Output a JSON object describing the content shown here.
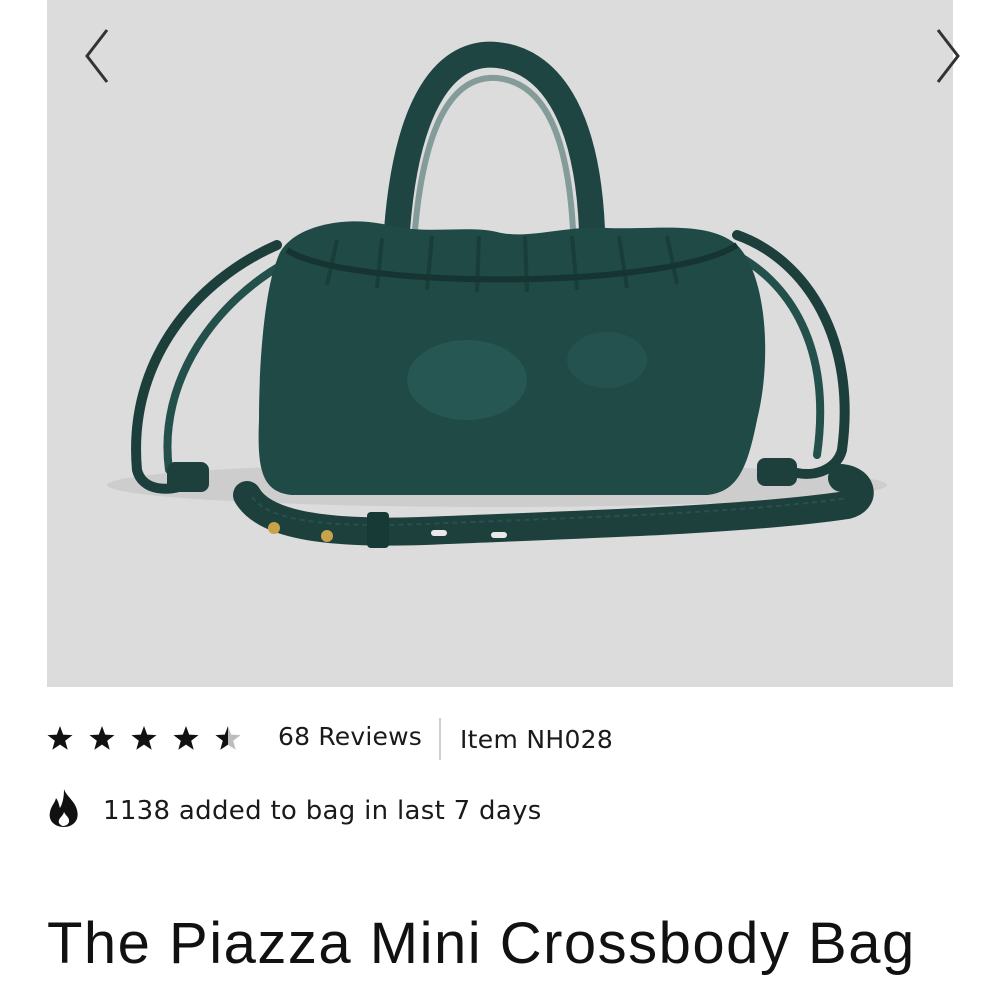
{
  "gallery": {
    "image_alt": "The Piazza Mini Crossbody Bag in dark green leather",
    "prev_icon": "chevron-left-icon",
    "next_icon": "chevron-right-icon",
    "background": "#dcdcdc",
    "bag_color": "#1f4a46"
  },
  "rating": {
    "value": 4.5,
    "max": 5,
    "reviews_label": "68 Reviews"
  },
  "item": {
    "label": "Item NH028"
  },
  "social_proof": {
    "icon": "fire-icon",
    "text": "1138 added to bag in last 7 days"
  },
  "product": {
    "title": "The Piazza Mini Crossbody Bag"
  }
}
